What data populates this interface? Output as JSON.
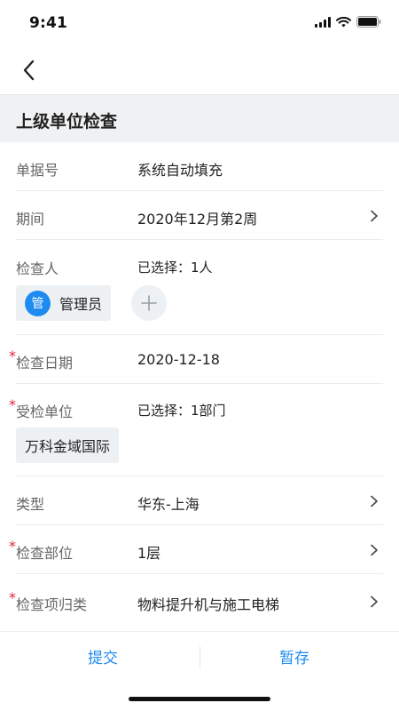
{
  "status": {
    "time": "9:41"
  },
  "section": {
    "title": "上级单位检查"
  },
  "form": {
    "doc_no": {
      "label": "单据号",
      "value": "系统自动填充"
    },
    "period": {
      "label": "期间",
      "value": "2020年12月第2周"
    },
    "inspector": {
      "label": "检查人",
      "selected": "已选择：1人",
      "chip_avatar": "管",
      "chip_name": "管理员"
    },
    "date": {
      "label": "检查日期",
      "value": "2020-12-18"
    },
    "inspected_unit": {
      "label": "受检单位",
      "selected": "已选择：1部门",
      "chip_name": "万科金域国际"
    },
    "type": {
      "label": "类型",
      "value": "华东-上海"
    },
    "location": {
      "label": "检查部位",
      "value": "1层"
    },
    "category": {
      "label": "检查项归类",
      "value": "物料提升机与施工电梯"
    }
  },
  "actions": {
    "submit": "提交",
    "save_draft": "暂存"
  },
  "required_mark": "*",
  "colors": {
    "accent": "#1e8bf1",
    "required": "#e0243a",
    "header_bg": "#f0f1f3"
  }
}
